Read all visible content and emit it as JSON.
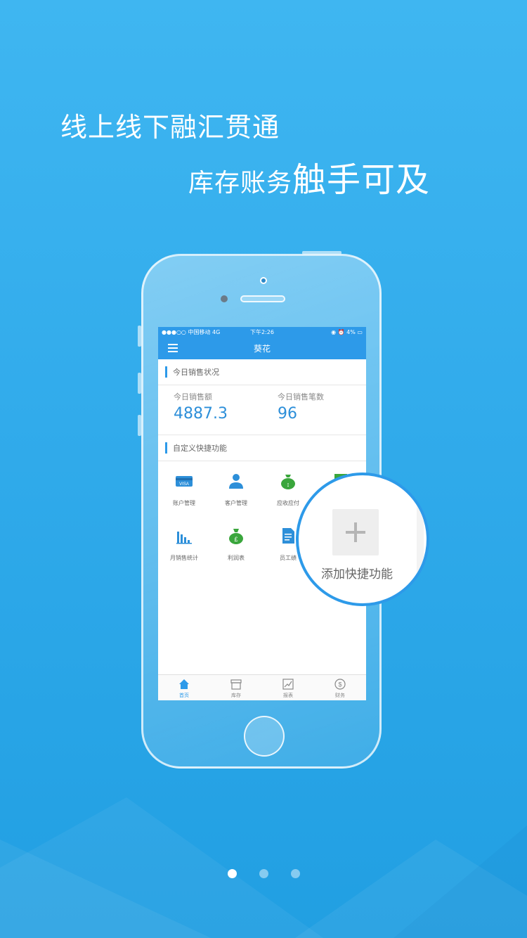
{
  "headline": {
    "line1": "线上线下融汇贯通",
    "line2_small": "库存账务",
    "line2_big": "触手可及"
  },
  "status_bar": {
    "carrier": "●●●○○ 中国移动  4G",
    "time": "下午2:26",
    "battery": "◉ ⏰ 4% ▭"
  },
  "app": {
    "title": "葵花",
    "sales_section": "今日销售状况",
    "stats": [
      {
        "label": "今日销售额",
        "value": "4887.3"
      },
      {
        "label": "今日销售笔数",
        "value": "96"
      }
    ],
    "shortcut_section": "自定义快捷功能",
    "shortcuts": [
      {
        "label": "账户管理",
        "icon": "visa-card-icon"
      },
      {
        "label": "客户管理",
        "icon": "customer-icon"
      },
      {
        "label": "应收应付",
        "icon": "money-bag-icon"
      },
      {
        "label": "",
        "icon": "partial-icon"
      },
      {
        "label": "月销售统计",
        "icon": "bar-chart-icon"
      },
      {
        "label": "利润表",
        "icon": "profit-bag-icon"
      },
      {
        "label": "员工绩",
        "icon": "document-icon"
      }
    ],
    "tabs": [
      {
        "label": "首页",
        "icon": "home-icon",
        "active": true
      },
      {
        "label": "库存",
        "icon": "inventory-icon",
        "active": false
      },
      {
        "label": "报表",
        "icon": "report-icon",
        "active": false
      },
      {
        "label": "财务",
        "icon": "finance-icon",
        "active": false
      }
    ]
  },
  "magnifier": {
    "label": "添加快捷功能"
  },
  "pager": {
    "count": 3,
    "active_index": 0
  },
  "colors": {
    "accent": "#2d9ae9",
    "background": "#31abeb",
    "green": "#3aa63c"
  }
}
